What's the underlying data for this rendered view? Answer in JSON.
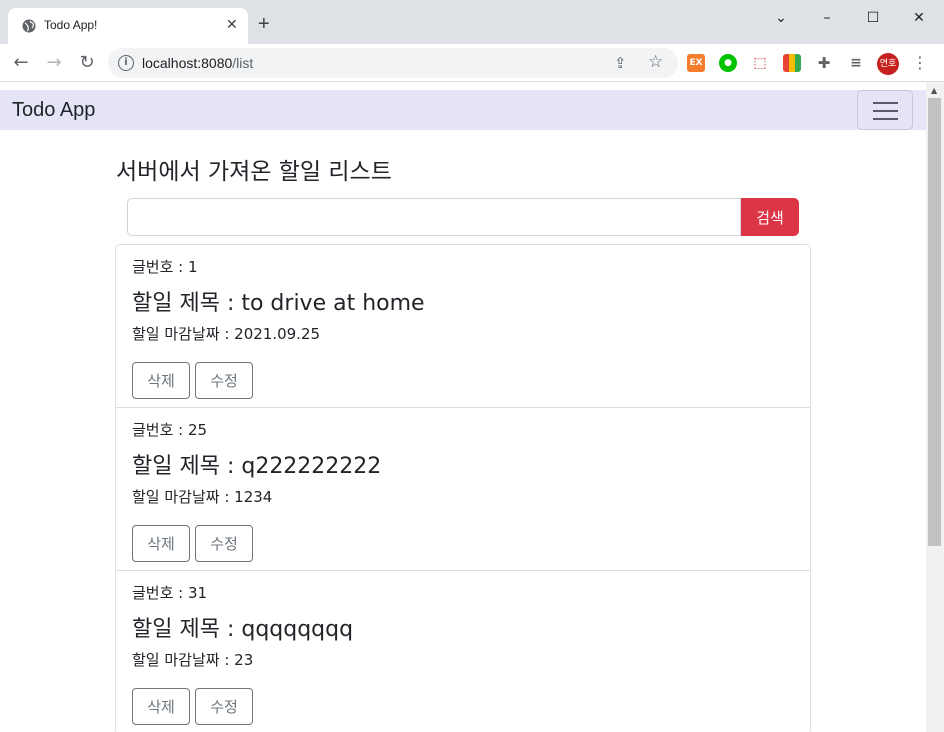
{
  "browser": {
    "tab_title": "Todo App!",
    "tab_close": "✕",
    "new_tab": "+",
    "url_host": "localhost:8080",
    "url_path": "/list",
    "avatar_text": "연호"
  },
  "app": {
    "brand": "Todo App",
    "heading": "서버에서 가져온 할일 리스트",
    "search": {
      "value": "",
      "button_label": "검색"
    }
  },
  "todos": [
    {
      "no": "글번호 : 1",
      "title": "할일 제목 : to drive at home",
      "date": "할일 마감날짜 : 2021.09.25",
      "delete_label": "삭제",
      "edit_label": "수정"
    },
    {
      "no": "글번호 : 25",
      "title": "할일 제목 : q222222222",
      "date": "할일 마감날짜 : 1234",
      "delete_label": "삭제",
      "edit_label": "수정"
    },
    {
      "no": "글번호 : 31",
      "title": "할일 제목 : qqqqqqqq",
      "date": "할일 마감날짜 : 23",
      "delete_label": "삭제",
      "edit_label": "수정"
    }
  ],
  "colors": {
    "navbar_bg": "#e5e5f7",
    "search_button": "#dc3545",
    "outline_button": "#6c757d"
  }
}
